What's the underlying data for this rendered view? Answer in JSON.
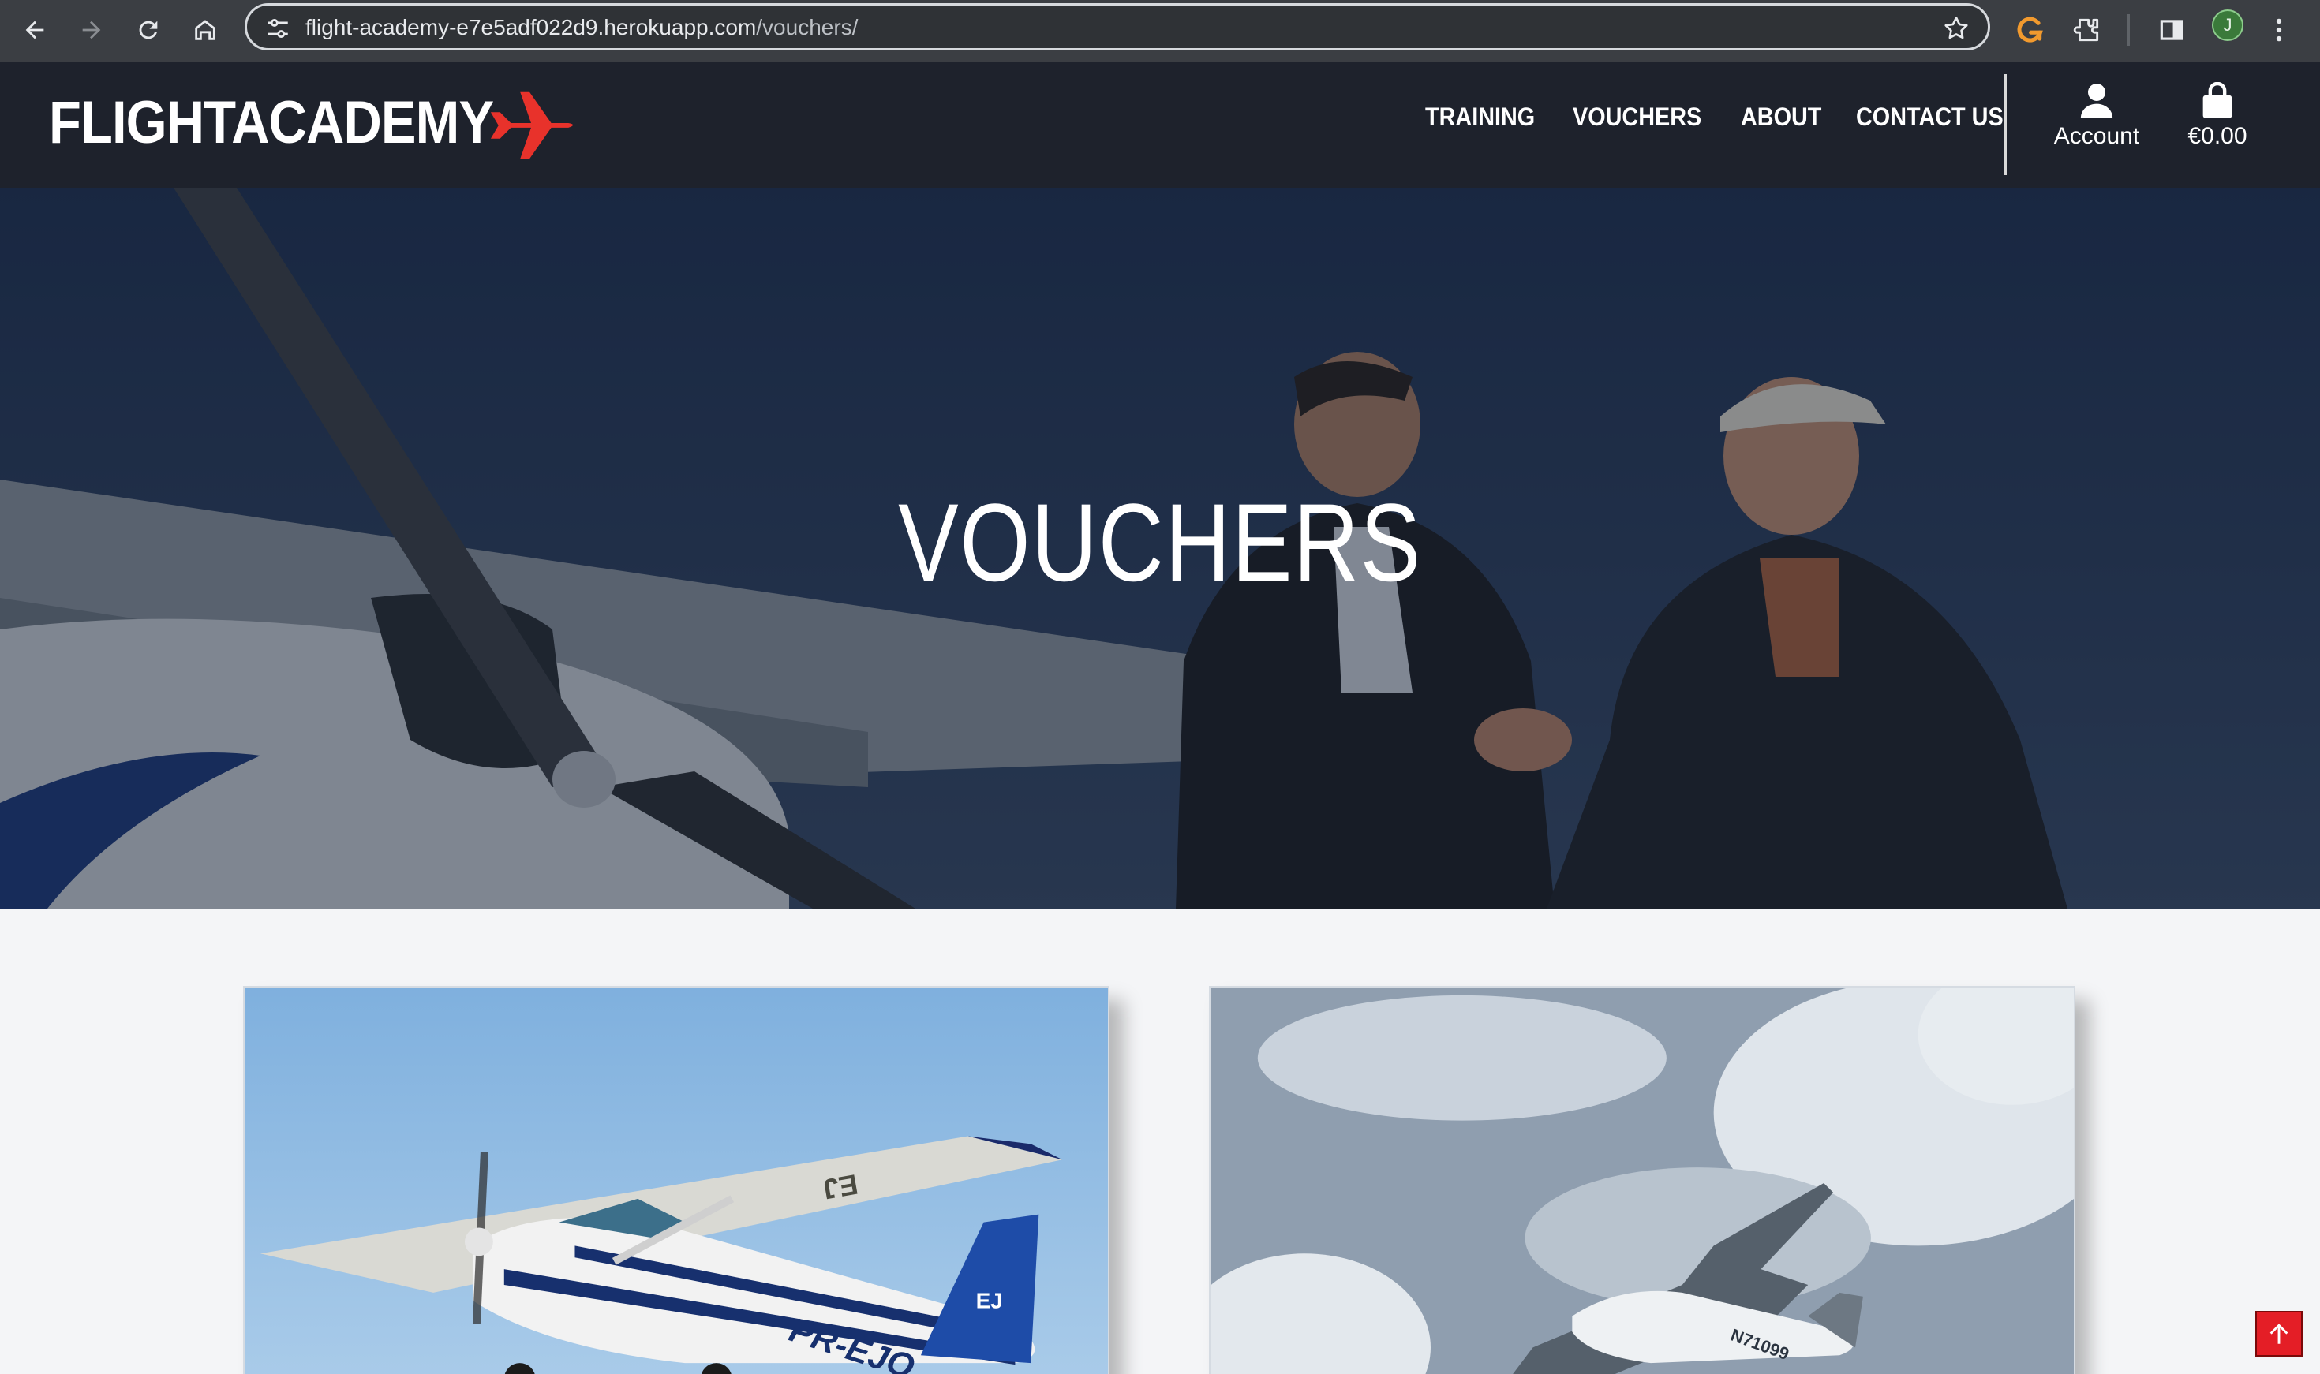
{
  "browser": {
    "url_host": "flight-academy-e7e5adf022d9.herokuapp.com",
    "url_path": "/vouchers/",
    "profile_initial": "J",
    "icons": [
      "back-icon",
      "forward-icon",
      "reload-icon",
      "home-icon",
      "site-settings-icon",
      "bookmark-star-icon",
      "grammarly-extension-icon",
      "extensions-puzzle-icon",
      "side-panel-icon",
      "menu-kebab-icon"
    ]
  },
  "header": {
    "logo_text": "FLIGHTACADEMY",
    "logo_icon": "plane-icon",
    "logo_color": "#e8322b",
    "nav": [
      {
        "label": "TRAINING"
      },
      {
        "label": "VOUCHERS"
      },
      {
        "label": "ABOUT"
      },
      {
        "label": "CONTACT US"
      }
    ],
    "account_label": "Account",
    "cart_total": "€0.00",
    "bg_color": "#1e222c"
  },
  "hero": {
    "title": "VOUCHERS"
  },
  "cards": [
    {
      "image": "blue-white-cessna-pr-ejq",
      "registration": "PR-EJQ",
      "tail_marking": "EJ"
    },
    {
      "image": "cessna-in-cloudy-sky",
      "registration": "N71099"
    }
  ],
  "back_to_top_icon": "arrow-up-icon",
  "accent_red": "#e41e26"
}
